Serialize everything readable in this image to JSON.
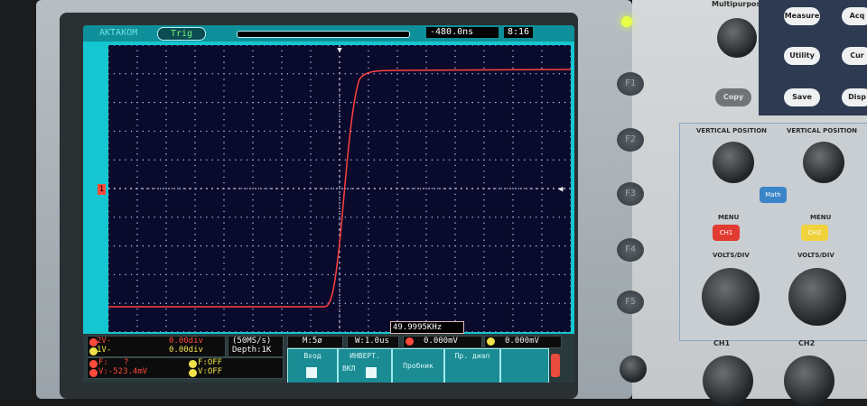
{
  "screen": {
    "brand": "AKTAKOM",
    "trig_label": "Trig",
    "trigger_position": "-480.0ns",
    "clock": "8:16",
    "channel_marker": "1",
    "frequency_readout": "49.9995KHz"
  },
  "status": {
    "ch2_label": "2V-",
    "ch2_value": "0.00div",
    "ch1_label": "1V-",
    "ch1_value": "0.00div",
    "sample_rate": "(50MS/s)",
    "depth": "Depth:1K",
    "f_label": "F:",
    "f_value": "?",
    "v_readout": "V:-523.4mV",
    "f_off": "F:OFF",
    "v_off": "V:OFF",
    "timebase": "M:5ø",
    "window": "W:1.0us",
    "trig_level_1": "0.000mV",
    "trig_level_2": "0.000mV"
  },
  "menu": {
    "item1": "Вход",
    "item2": "ИНВЕРТ.",
    "item2b": "ВКЛ",
    "item3": "Пробник",
    "item4": "Пр. диап"
  },
  "panel": {
    "multipurpose": "Multipurpose",
    "copy": "Copy",
    "measure": "Measure",
    "acq": "Acq",
    "utility": "Utility",
    "cur": "Cur",
    "save": "Save",
    "disp": "Disp",
    "f1": "F1",
    "f2": "F2",
    "f3": "F3",
    "f4": "F4",
    "f5": "F5",
    "vertical_position_1": "VERTICAL POSITION",
    "vertical_position_2": "VERTICAL POSITION",
    "math": "Math",
    "menu1": "MENU",
    "menu2": "MENU",
    "ch1_btn": "CH1",
    "ch2_btn": "CH2",
    "volts_div_1": "VOLTS/DIV",
    "volts_div_2": "VOLTS/DIV",
    "ch1_label": "CH1",
    "ch2_label": "CH2"
  },
  "colors": {
    "screen_bg": "#14c6cf",
    "grid_bg": "#0a0a2c",
    "trace": "#ff3a3a",
    "ch1": "#f0e24a",
    "ch2": "#ff4a3c"
  }
}
